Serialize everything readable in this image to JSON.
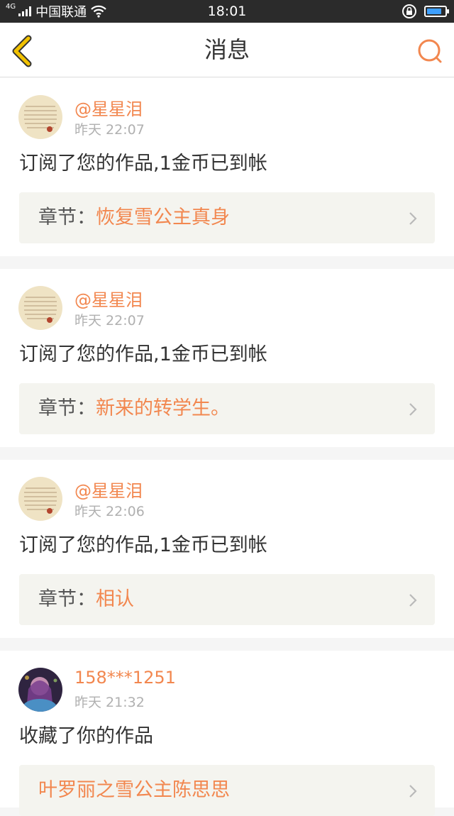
{
  "status_bar": {
    "network": "4G",
    "carrier": "中国联通",
    "time": "18:01",
    "battery_level": 0.85
  },
  "header": {
    "title": "消息"
  },
  "notifications": [
    {
      "user": "@星星泪",
      "time": "昨天 22:07",
      "message": "订阅了您的作品,1金币已到帐",
      "chapter_label": "章节：",
      "chapter_name": "恢复雪公主真身"
    },
    {
      "user": "@星星泪",
      "time": "昨天 22:07",
      "message": "订阅了您的作品,1金币已到帐",
      "chapter_label": "章节：",
      "chapter_name": "新来的转学生。"
    },
    {
      "user": "@星星泪",
      "time": "昨天 22:06",
      "message": "订阅了您的作品,1金币已到帐",
      "chapter_label": "章节：",
      "chapter_name": "相认"
    },
    {
      "user": "158***1251",
      "time": "昨天 21:32",
      "message": "收藏了你的作品",
      "chapter_label": "",
      "chapter_name": "叶罗丽之雪公主陈思思"
    }
  ],
  "colors": {
    "accent": "#f2874f",
    "back_icon": "#f2c200"
  }
}
